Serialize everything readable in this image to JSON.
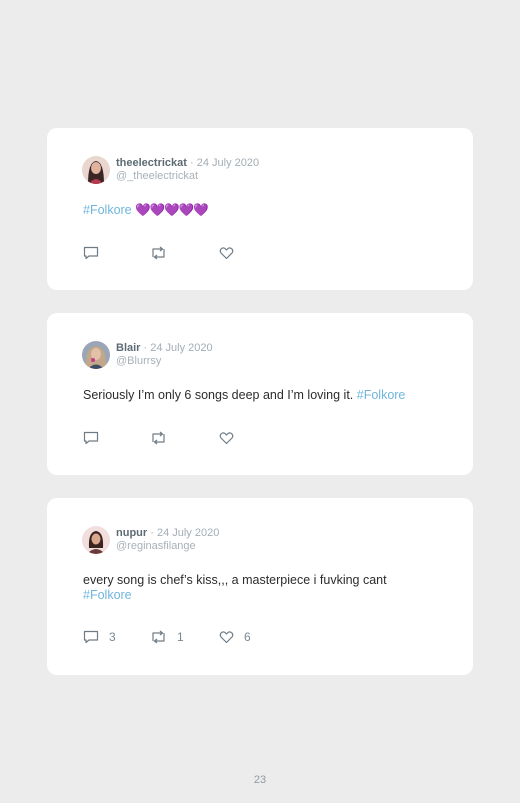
{
  "tweets": [
    {
      "name": "theelectrickat",
      "date": "· 24 July 2020",
      "handle": "@_theelectrickat",
      "hashtag": "#Folkore",
      "hearts": "💜💜💜💜💜",
      "text_before": "",
      "reply_count": "",
      "retweet_count": "",
      "like_count": "",
      "avatar_color": "#8a3b46"
    },
    {
      "name": "Blair",
      "date": "· 24 July 2020",
      "handle": "@Blurrsy",
      "text_before": "Seriously I’m only 6 songs deep and I’m loving it. ",
      "hashtag": "#Folkore",
      "reply_count": "",
      "retweet_count": "",
      "like_count": "",
      "avatar_color": "#4a5a78"
    },
    {
      "name": "nupur",
      "date": "· 24 July 2020",
      "handle": "@reginasfilange",
      "text_before": "every song is chef’s kiss,,, a masterpiece i fuvking cant ",
      "hashtag": "#Folkore",
      "reply_count": "3",
      "retweet_count": "1",
      "like_count": "6",
      "avatar_color": "#6a3a3a"
    }
  ],
  "page_number": "23",
  "colors": {
    "background": "#ececec",
    "card": "#ffffff",
    "hashtag": "#6fb6dd",
    "heart_emoji": "#a486d6",
    "icon": "#6f7b85"
  },
  "icons": [
    "reply-icon",
    "retweet-icon",
    "like-icon"
  ]
}
